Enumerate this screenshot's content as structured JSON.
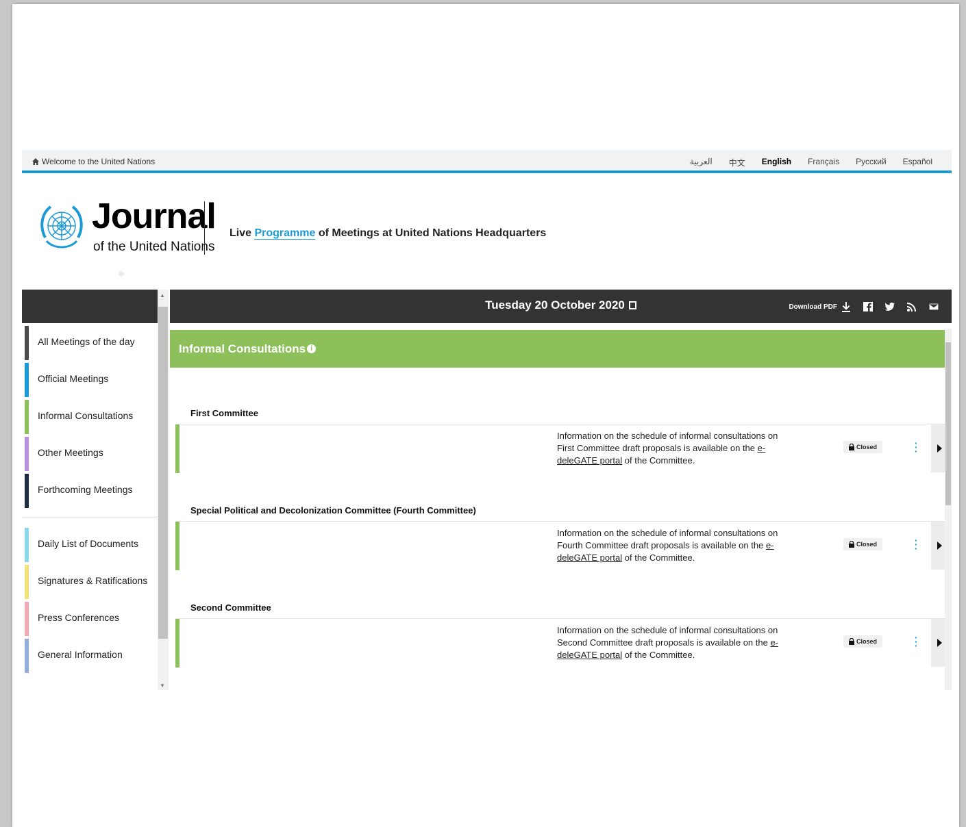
{
  "util": {
    "home_label": "Welcome to the United Nations",
    "languages": [
      "العربية",
      "中文",
      "English",
      "Français",
      "Русский",
      "Español"
    ],
    "active_language": "English"
  },
  "header": {
    "journal_title": "Journal",
    "journal_subtitle": "of the United Nations",
    "tagline_prefix": "Live ",
    "tagline_highlight": "Programme",
    "tagline_suffix": " of Meetings at United Nations Headquarters"
  },
  "sidebar": {
    "items": [
      {
        "label": "All Meetings of the day",
        "color": "#4a4a4a"
      },
      {
        "label": "Official Meetings",
        "color": "#1b9ad6"
      },
      {
        "label": "Informal Consultations",
        "color": "#8dc05a"
      },
      {
        "label": "Other Meetings",
        "color": "#b88fdc"
      },
      {
        "label": "Forthcoming Meetings",
        "color": "#1f2d44"
      }
    ],
    "items2": [
      {
        "label": "Daily List of Documents",
        "color": "#8ad9ea"
      },
      {
        "label": "Signatures & Ratifications",
        "color": "#f0e17a"
      },
      {
        "label": "Press Conferences",
        "color": "#f2aab5"
      },
      {
        "label": "General Information",
        "color": "#93aedc"
      }
    ]
  },
  "datebar": {
    "date": "Tuesday 20 October 2020",
    "download_label": "Download PDF"
  },
  "section": {
    "title": "Informal Consultations"
  },
  "committees": [
    {
      "title": "First Committee",
      "desc_before": "Information on the schedule of informal consultations on First Committee draft proposals is available on the ",
      "link": "e-deleGATE portal",
      "desc_after": " of the Committee.",
      "status": "Closed"
    },
    {
      "title": "Special Political and Decolonization Committee (Fourth Committee)",
      "desc_before": "Information on the schedule of informal consultations on Fourth Committee draft proposals is available on the ",
      "link": "e-deleGATE portal",
      "desc_after": " of the Committee.",
      "status": "Closed"
    },
    {
      "title": "Second Committee",
      "desc_before": "Information on the schedule of informal consultations on Second Committee draft proposals is available on the ",
      "link": "e-deleGATE portal",
      "desc_after": " of the Committee.",
      "status": "Closed"
    }
  ],
  "colors": {
    "accent_blue": "#1b9ad6",
    "informal_green": "#8dc05a",
    "dark_bar": "#333333"
  }
}
